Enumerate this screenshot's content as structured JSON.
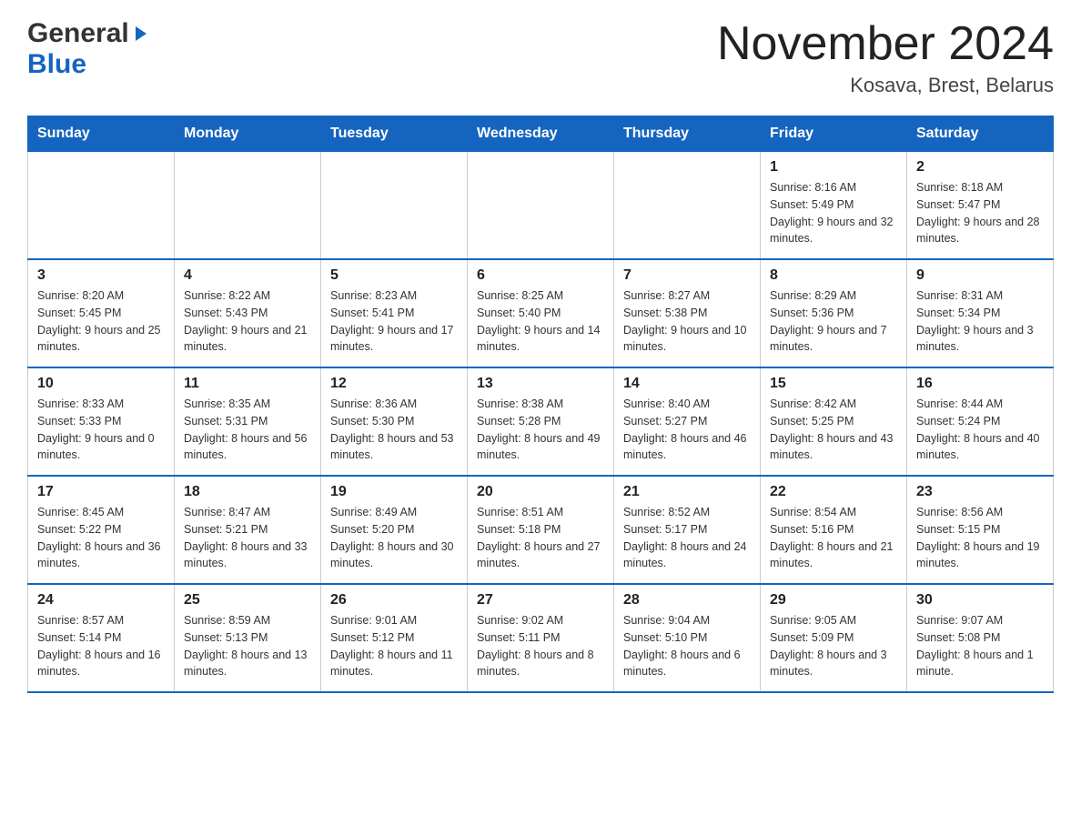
{
  "header": {
    "logo_general": "General",
    "logo_blue": "Blue",
    "title": "November 2024",
    "subtitle": "Kosava, Brest, Belarus"
  },
  "days_of_week": [
    "Sunday",
    "Monday",
    "Tuesday",
    "Wednesday",
    "Thursday",
    "Friday",
    "Saturday"
  ],
  "weeks": [
    [
      {
        "day": "",
        "info": ""
      },
      {
        "day": "",
        "info": ""
      },
      {
        "day": "",
        "info": ""
      },
      {
        "day": "",
        "info": ""
      },
      {
        "day": "",
        "info": ""
      },
      {
        "day": "1",
        "info": "Sunrise: 8:16 AM\nSunset: 5:49 PM\nDaylight: 9 hours and 32 minutes."
      },
      {
        "day": "2",
        "info": "Sunrise: 8:18 AM\nSunset: 5:47 PM\nDaylight: 9 hours and 28 minutes."
      }
    ],
    [
      {
        "day": "3",
        "info": "Sunrise: 8:20 AM\nSunset: 5:45 PM\nDaylight: 9 hours and 25 minutes."
      },
      {
        "day": "4",
        "info": "Sunrise: 8:22 AM\nSunset: 5:43 PM\nDaylight: 9 hours and 21 minutes."
      },
      {
        "day": "5",
        "info": "Sunrise: 8:23 AM\nSunset: 5:41 PM\nDaylight: 9 hours and 17 minutes."
      },
      {
        "day": "6",
        "info": "Sunrise: 8:25 AM\nSunset: 5:40 PM\nDaylight: 9 hours and 14 minutes."
      },
      {
        "day": "7",
        "info": "Sunrise: 8:27 AM\nSunset: 5:38 PM\nDaylight: 9 hours and 10 minutes."
      },
      {
        "day": "8",
        "info": "Sunrise: 8:29 AM\nSunset: 5:36 PM\nDaylight: 9 hours and 7 minutes."
      },
      {
        "day": "9",
        "info": "Sunrise: 8:31 AM\nSunset: 5:34 PM\nDaylight: 9 hours and 3 minutes."
      }
    ],
    [
      {
        "day": "10",
        "info": "Sunrise: 8:33 AM\nSunset: 5:33 PM\nDaylight: 9 hours and 0 minutes."
      },
      {
        "day": "11",
        "info": "Sunrise: 8:35 AM\nSunset: 5:31 PM\nDaylight: 8 hours and 56 minutes."
      },
      {
        "day": "12",
        "info": "Sunrise: 8:36 AM\nSunset: 5:30 PM\nDaylight: 8 hours and 53 minutes."
      },
      {
        "day": "13",
        "info": "Sunrise: 8:38 AM\nSunset: 5:28 PM\nDaylight: 8 hours and 49 minutes."
      },
      {
        "day": "14",
        "info": "Sunrise: 8:40 AM\nSunset: 5:27 PM\nDaylight: 8 hours and 46 minutes."
      },
      {
        "day": "15",
        "info": "Sunrise: 8:42 AM\nSunset: 5:25 PM\nDaylight: 8 hours and 43 minutes."
      },
      {
        "day": "16",
        "info": "Sunrise: 8:44 AM\nSunset: 5:24 PM\nDaylight: 8 hours and 40 minutes."
      }
    ],
    [
      {
        "day": "17",
        "info": "Sunrise: 8:45 AM\nSunset: 5:22 PM\nDaylight: 8 hours and 36 minutes."
      },
      {
        "day": "18",
        "info": "Sunrise: 8:47 AM\nSunset: 5:21 PM\nDaylight: 8 hours and 33 minutes."
      },
      {
        "day": "19",
        "info": "Sunrise: 8:49 AM\nSunset: 5:20 PM\nDaylight: 8 hours and 30 minutes."
      },
      {
        "day": "20",
        "info": "Sunrise: 8:51 AM\nSunset: 5:18 PM\nDaylight: 8 hours and 27 minutes."
      },
      {
        "day": "21",
        "info": "Sunrise: 8:52 AM\nSunset: 5:17 PM\nDaylight: 8 hours and 24 minutes."
      },
      {
        "day": "22",
        "info": "Sunrise: 8:54 AM\nSunset: 5:16 PM\nDaylight: 8 hours and 21 minutes."
      },
      {
        "day": "23",
        "info": "Sunrise: 8:56 AM\nSunset: 5:15 PM\nDaylight: 8 hours and 19 minutes."
      }
    ],
    [
      {
        "day": "24",
        "info": "Sunrise: 8:57 AM\nSunset: 5:14 PM\nDaylight: 8 hours and 16 minutes."
      },
      {
        "day": "25",
        "info": "Sunrise: 8:59 AM\nSunset: 5:13 PM\nDaylight: 8 hours and 13 minutes."
      },
      {
        "day": "26",
        "info": "Sunrise: 9:01 AM\nSunset: 5:12 PM\nDaylight: 8 hours and 11 minutes."
      },
      {
        "day": "27",
        "info": "Sunrise: 9:02 AM\nSunset: 5:11 PM\nDaylight: 8 hours and 8 minutes."
      },
      {
        "day": "28",
        "info": "Sunrise: 9:04 AM\nSunset: 5:10 PM\nDaylight: 8 hours and 6 minutes."
      },
      {
        "day": "29",
        "info": "Sunrise: 9:05 AM\nSunset: 5:09 PM\nDaylight: 8 hours and 3 minutes."
      },
      {
        "day": "30",
        "info": "Sunrise: 9:07 AM\nSunset: 5:08 PM\nDaylight: 8 hours and 1 minute."
      }
    ]
  ]
}
